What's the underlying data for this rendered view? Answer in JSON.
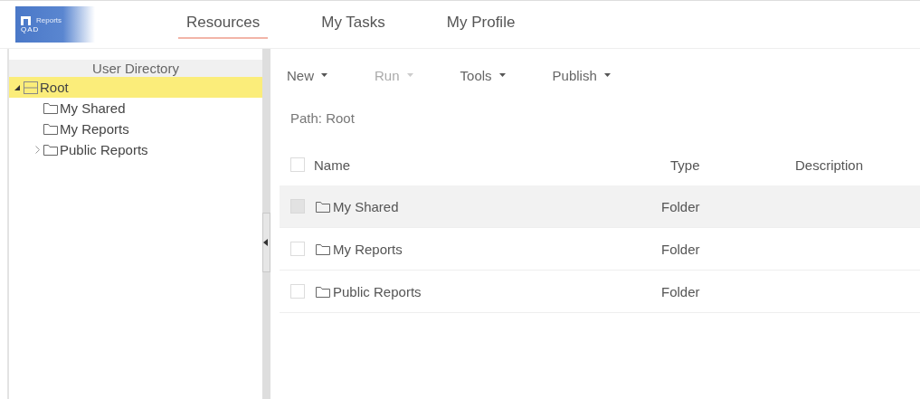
{
  "logo": {
    "app": "Reports",
    "brand": "QAD"
  },
  "nav": [
    {
      "label": "Resources",
      "selected": true
    },
    {
      "label": "My Tasks",
      "selected": false
    },
    {
      "label": "My Profile",
      "selected": false
    }
  ],
  "sidebar": {
    "title": "User Directory",
    "tree": [
      {
        "label": "Root",
        "kind": "root",
        "selected": true,
        "expanded": true,
        "children": [
          {
            "label": "My Shared",
            "kind": "folder",
            "selected": false,
            "expanded": false
          },
          {
            "label": "My Reports",
            "kind": "folder",
            "selected": false,
            "expanded": false
          },
          {
            "label": "Public Reports",
            "kind": "folder",
            "selected": false,
            "expanded": false,
            "expandable": true
          }
        ]
      }
    ]
  },
  "toolbar": [
    {
      "label": "New",
      "disabled": false
    },
    {
      "label": "Run",
      "disabled": true
    },
    {
      "label": "Tools",
      "disabled": false
    },
    {
      "label": "Publish",
      "disabled": false
    }
  ],
  "path": "Path: Root",
  "table": {
    "columns": [
      "Name",
      "Type",
      "Description"
    ],
    "all_checked": false,
    "rows": [
      {
        "name": "My Shared",
        "type": "Folder",
        "selected": true
      },
      {
        "name": "My Reports",
        "type": "Folder",
        "selected": false
      },
      {
        "name": "Public Reports",
        "type": "Folder",
        "selected": false
      }
    ]
  }
}
